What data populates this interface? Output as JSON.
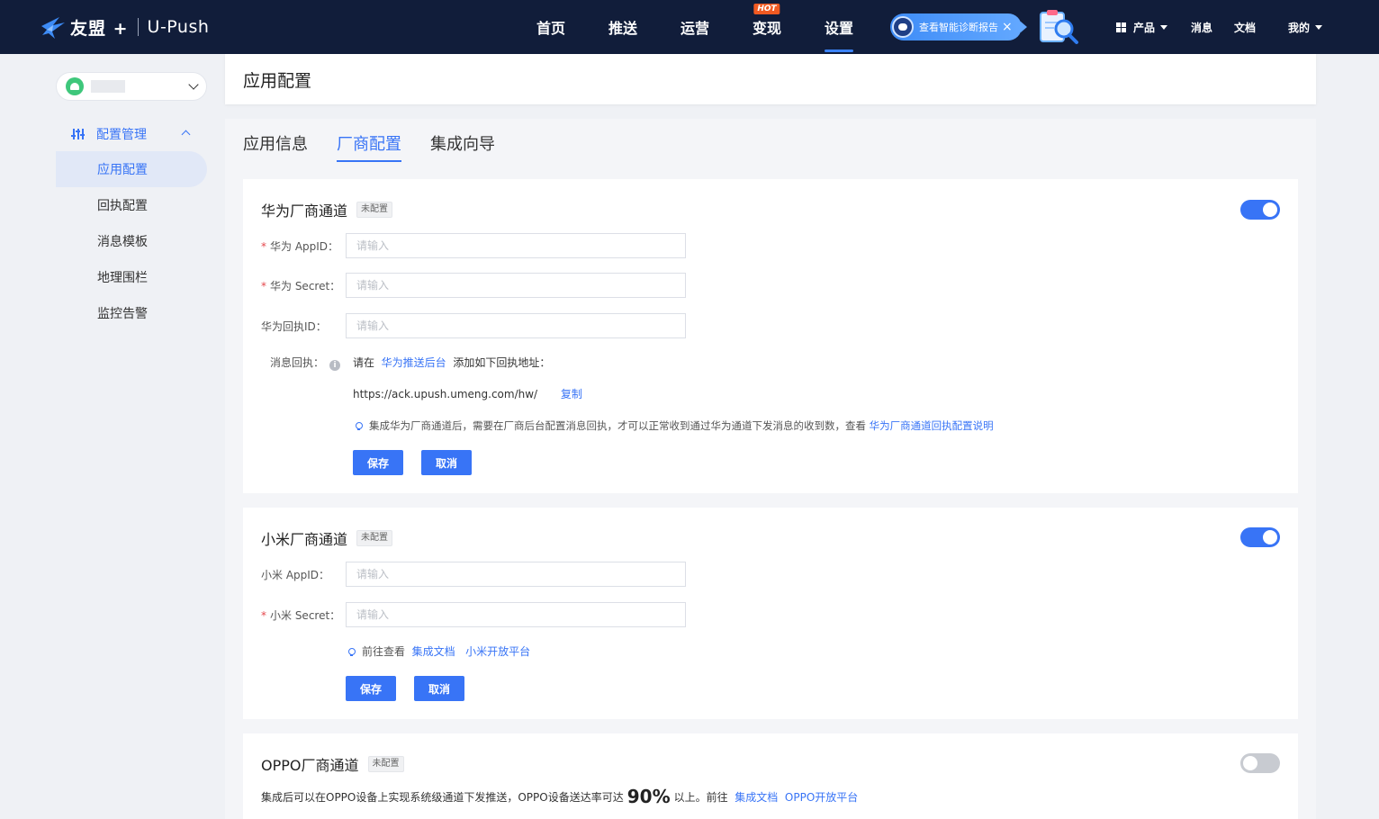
{
  "header": {
    "logo_brand": "友盟 +",
    "logo_product": "U-Push",
    "nav": [
      {
        "label": "首页"
      },
      {
        "label": "推送"
      },
      {
        "label": "运营"
      },
      {
        "label": "变现",
        "badge": "HOT"
      },
      {
        "label": "设置",
        "active": true
      }
    ],
    "diagnosis_label": "查看智能诊断报告",
    "diagnosis_close": "×",
    "right_nav": {
      "products": "产品",
      "messages": "消息",
      "docs": "文档",
      "mine": "我的"
    }
  },
  "sidebar": {
    "app_selector": {
      "platform_icon": "android-icon",
      "name": "██"
    },
    "group_label": "配置管理",
    "items": [
      {
        "label": "应用配置",
        "active": true
      },
      {
        "label": "回执配置"
      },
      {
        "label": "消息模板"
      },
      {
        "label": "地理围栏"
      },
      {
        "label": "监控告警"
      }
    ]
  },
  "page": {
    "title": "应用配置",
    "tabs": [
      {
        "label": "应用信息"
      },
      {
        "label": "厂商配置",
        "active": true
      },
      {
        "label": "集成向导"
      }
    ]
  },
  "huawei": {
    "title": "华为厂商通道",
    "status": "未配置",
    "enabled": true,
    "appid_label": "华为 AppID：",
    "secret_label": "华为 Secret：",
    "receipt_id_label": "华为回执ID：",
    "placeholder": "请输入",
    "receipt_label": "消息回执：",
    "receipt_prefix": "请在",
    "receipt_link": "华为推送后台",
    "receipt_suffix": "添加如下回执地址：",
    "receipt_url": "https://ack.upush.umeng.com/hw/",
    "copy": "复制",
    "tip_text": "集成华为厂商通道后，需要在厂商后台配置消息回执，才可以正常收到通过华为通道下发消息的收到数，查看",
    "tip_link": "华为厂商通道回执配置说明",
    "save": "保存",
    "cancel": "取消"
  },
  "xiaomi": {
    "title": "小米厂商通道",
    "status": "未配置",
    "enabled": true,
    "appid_label": "小米 AppID：",
    "secret_label": "小米 Secret：",
    "placeholder": "请输入",
    "tip_prefix": "前往查看",
    "tip_link_docs": "集成文档",
    "tip_link_platform": "小米开放平台",
    "save": "保存",
    "cancel": "取消"
  },
  "oppo": {
    "title": "OPPO厂商通道",
    "status": "未配置",
    "enabled": false,
    "desc_prefix": "集成后可以在OPPO设备上实现系统级通道下发推送，OPPO设备送达率可达",
    "desc_rate": "90%",
    "desc_suffix": "以上。前往",
    "link_docs": "集成文档",
    "link_platform": "OPPO开放平台"
  },
  "colors": {
    "header_bg": "#111d3a",
    "accent": "#3874f6",
    "hot": "#f05a22",
    "required": "#e5484d"
  }
}
